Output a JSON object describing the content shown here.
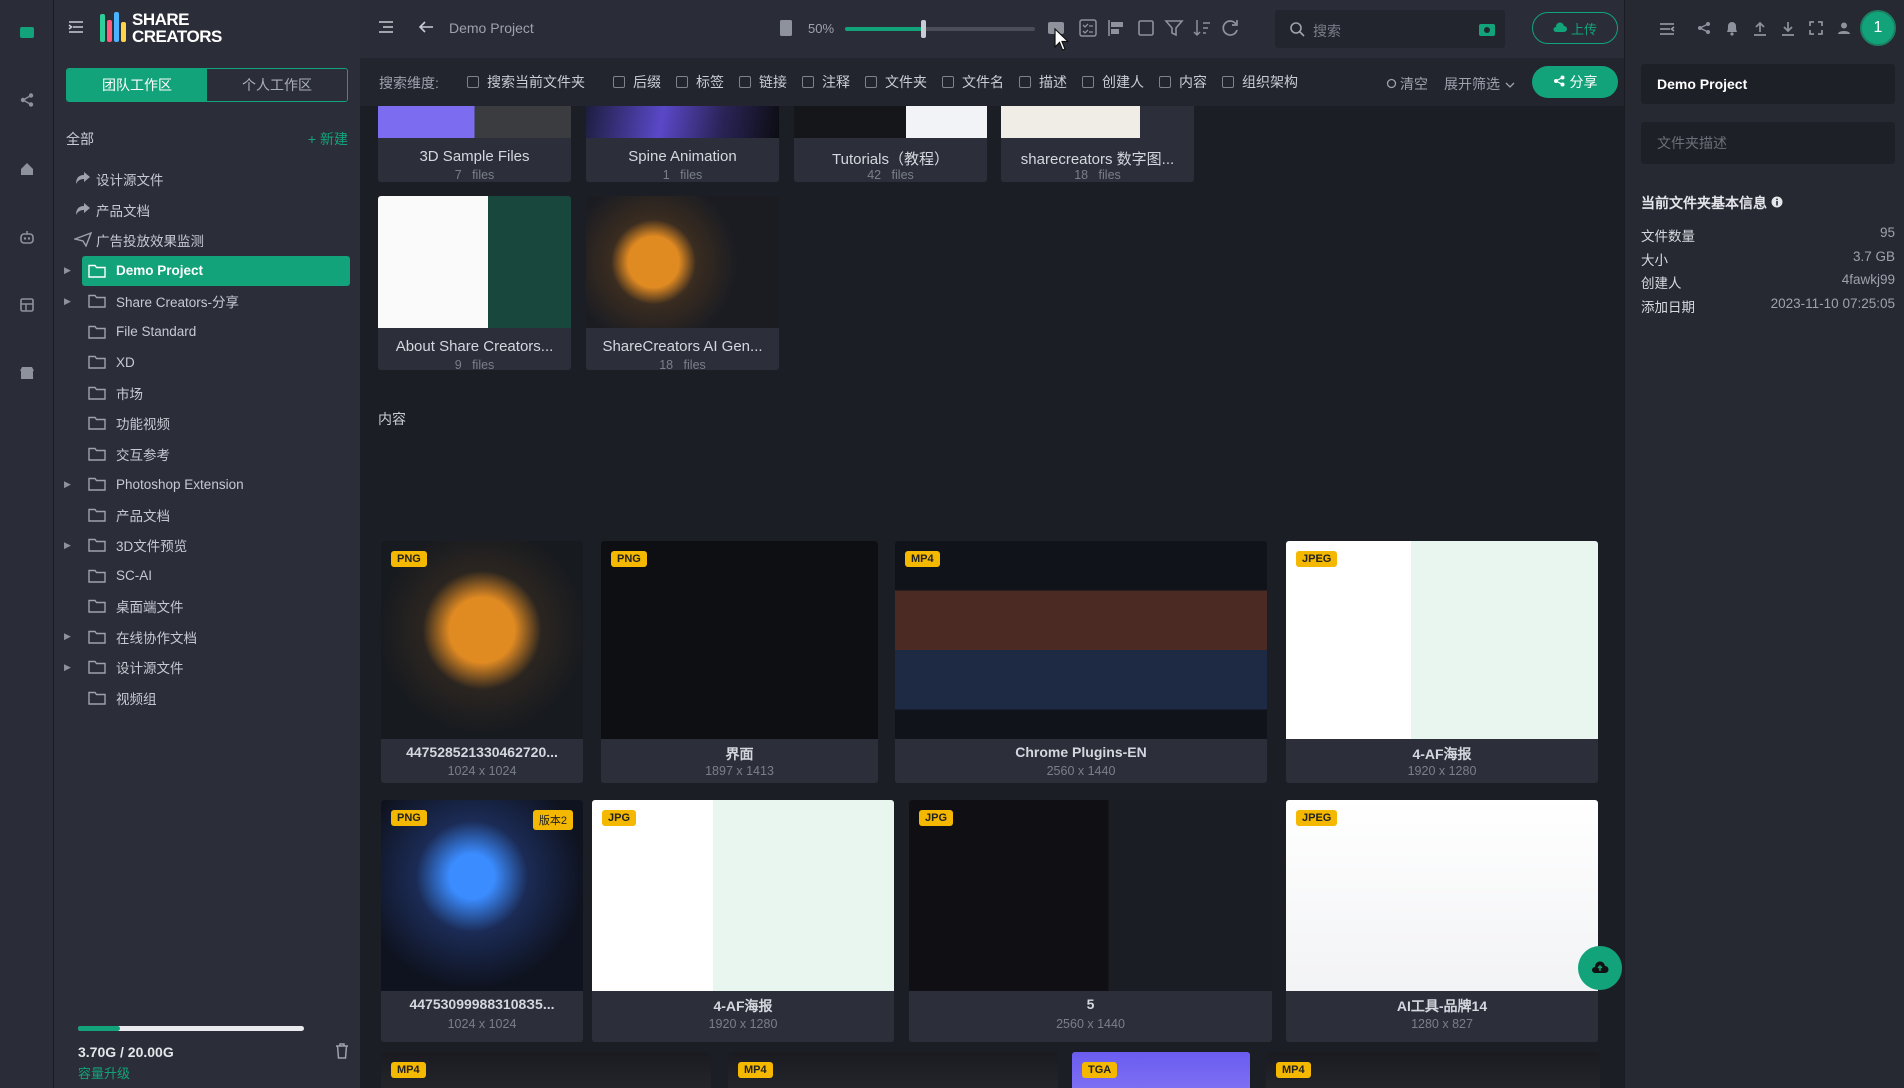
{
  "colors": {
    "accent": "#12a37a",
    "badge": "#f5b800"
  },
  "app": {
    "logo_line1": "SHARE",
    "logo_line2": "CREATORS"
  },
  "rail": [
    "folder-icon",
    "share-icon",
    "home-icon",
    "robot-icon",
    "grid-icon",
    "store-icon"
  ],
  "workspace": {
    "team": "团队工作区",
    "personal": "个人工作区"
  },
  "tree_header": {
    "all": "全部",
    "new": "+ 新建"
  },
  "tree": [
    {
      "label": "设计源文件",
      "type": "share",
      "arrow": false
    },
    {
      "label": "产品文档",
      "type": "share",
      "arrow": false
    },
    {
      "label": "广告投放效果监测",
      "type": "send",
      "arrow": false
    },
    {
      "label": "Demo Project",
      "type": "folder",
      "arrow": true,
      "selected": true
    },
    {
      "label": "Share Creators-分享",
      "type": "folder",
      "arrow": true
    },
    {
      "label": "File Standard",
      "type": "folder",
      "arrow": false
    },
    {
      "label": "XD",
      "type": "folder",
      "arrow": false
    },
    {
      "label": "市场",
      "type": "folder",
      "arrow": false
    },
    {
      "label": "功能视频",
      "type": "folder",
      "arrow": false
    },
    {
      "label": "交互参考",
      "type": "folder",
      "arrow": false
    },
    {
      "label": "Photoshop Extension",
      "type": "folder",
      "arrow": true
    },
    {
      "label": "产品文档",
      "type": "folder",
      "arrow": false
    },
    {
      "label": "3D文件预览",
      "type": "folder",
      "arrow": true
    },
    {
      "label": "SC-AI",
      "type": "folder",
      "arrow": false
    },
    {
      "label": "桌面端文件",
      "type": "folder",
      "arrow": false
    },
    {
      "label": "在线协作文档",
      "type": "folder",
      "arrow": true
    },
    {
      "label": "设计源文件",
      "type": "folder",
      "arrow": true
    },
    {
      "label": "视频组",
      "type": "folder",
      "arrow": false
    }
  ],
  "storage": {
    "used": "3.70G / 20.00G",
    "fraction": 0.185,
    "upgrade": "容量升级"
  },
  "topbar": {
    "breadcrumb": "Demo Project",
    "zoom": "50%",
    "zoom_fraction": 0.5,
    "search_placeholder": "搜索",
    "upload": "上传"
  },
  "search_dims": {
    "label": "搜索维度:",
    "options": [
      "搜索当前文件夹",
      "后缀",
      "标签",
      "链接",
      "注释",
      "文件夹",
      "文件名",
      "描述",
      "创建人",
      "内容",
      "组织架构"
    ],
    "clear": "清空",
    "expand": "展开筛选",
    "share": "分享"
  },
  "folders": [
    {
      "name": "3D Sample Files",
      "count": "7",
      "unit": "files"
    },
    {
      "name": "Spine Animation",
      "count": "1",
      "unit": "files"
    },
    {
      "name": "Tutorials（教程）",
      "count": "42",
      "unit": "files"
    },
    {
      "name": "sharecreators 数字图...",
      "count": "18",
      "unit": "files"
    },
    {
      "name": "About Share Creators...",
      "count": "9",
      "unit": "files"
    },
    {
      "name": "ShareCreators AI Gen...",
      "count": "18",
      "unit": "files"
    }
  ],
  "content_heading": "内容",
  "files_row1": [
    {
      "type": "PNG",
      "name": "447528521330462720...",
      "dims": "1024 x 1024"
    },
    {
      "type": "PNG",
      "name": "界面",
      "dims": "1897 x 1413"
    },
    {
      "type": "MP4",
      "name": "Chrome Plugins-EN",
      "dims": "2560 x 1440"
    },
    {
      "type": "JPEG",
      "name": "4-AF海报",
      "dims": "1920 x 1280"
    }
  ],
  "files_row2": [
    {
      "type": "PNG",
      "name": "447530999883108З5...",
      "dims": "1024 x 1024",
      "version": "版本2"
    },
    {
      "type": "JPG",
      "name": "4-AF海报",
      "dims": "1920 x 1280"
    },
    {
      "type": "JPG",
      "name": "5",
      "dims": "2560 x 1440"
    },
    {
      "type": "JPEG",
      "name": "AI工具-品牌14",
      "dims": "1280 x 827"
    }
  ],
  "files_row3": [
    "MP4",
    "MP4",
    "TGA",
    "MP4"
  ],
  "right_panel": {
    "folder_name": "Demo Project",
    "desc_placeholder": "文件夹描述",
    "section": "当前文件夹基本信息",
    "rows": [
      {
        "k": "文件数量",
        "v": "95"
      },
      {
        "k": "大小",
        "v": "3.7 GB"
      },
      {
        "k": "创建人",
        "v": "4fawkj99"
      },
      {
        "k": "添加日期",
        "v": "2023-11-10 07:25:05"
      }
    ],
    "avatar": "1"
  }
}
